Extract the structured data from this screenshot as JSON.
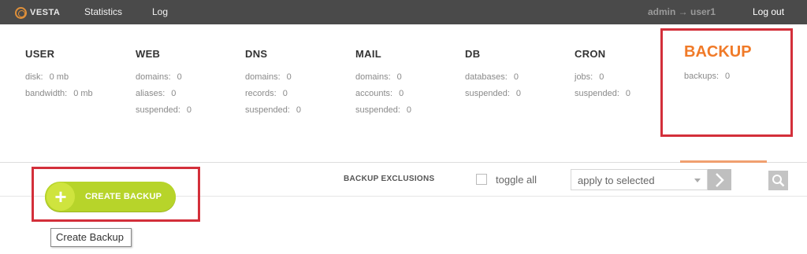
{
  "topbar": {
    "logo_text": "VESTA",
    "nav": {
      "statistics": "Statistics",
      "log": "Log"
    },
    "user": "admin → user1",
    "logout": "Log out"
  },
  "summary": {
    "user": {
      "title": "USER",
      "stats": [
        {
          "label": "disk:",
          "value": "0 mb"
        },
        {
          "label": "bandwidth:",
          "value": "0 mb"
        }
      ]
    },
    "web": {
      "title": "WEB",
      "stats": [
        {
          "label": "domains:",
          "value": "0"
        },
        {
          "label": "aliases:",
          "value": "0"
        },
        {
          "label": "suspended:",
          "value": "0"
        }
      ]
    },
    "dns": {
      "title": "DNS",
      "stats": [
        {
          "label": "domains:",
          "value": "0"
        },
        {
          "label": "records:",
          "value": "0"
        },
        {
          "label": "suspended:",
          "value": "0"
        }
      ]
    },
    "mail": {
      "title": "MAIL",
      "stats": [
        {
          "label": "domains:",
          "value": "0"
        },
        {
          "label": "accounts:",
          "value": "0"
        },
        {
          "label": "suspended:",
          "value": "0"
        }
      ]
    },
    "db": {
      "title": "DB",
      "stats": [
        {
          "label": "databases:",
          "value": "0"
        },
        {
          "label": "suspended:",
          "value": "0"
        }
      ]
    },
    "cron": {
      "title": "CRON",
      "stats": [
        {
          "label": "jobs:",
          "value": "0"
        },
        {
          "label": "suspended:",
          "value": "0"
        }
      ]
    },
    "backup": {
      "title": "BACKUP",
      "stats": [
        {
          "label": "backups:",
          "value": "0"
        }
      ]
    }
  },
  "toolbar": {
    "create_label": "CREATE BACKUP",
    "exclusions_label": "BACKUP EXCLUSIONS",
    "toggle_all": "toggle all",
    "select_value": "apply to selected"
  },
  "tooltip": "Create Backup",
  "colors": {
    "topbar": "#4a4a4a",
    "accent_orange": "#f07a28",
    "create_green": "#b7d42a",
    "highlight_red": "#d32f3a"
  },
  "icons": {
    "logo": "vesta-logo-icon",
    "plus": "plus-icon",
    "apply": "chevron-right-icon",
    "search": "search-icon"
  }
}
